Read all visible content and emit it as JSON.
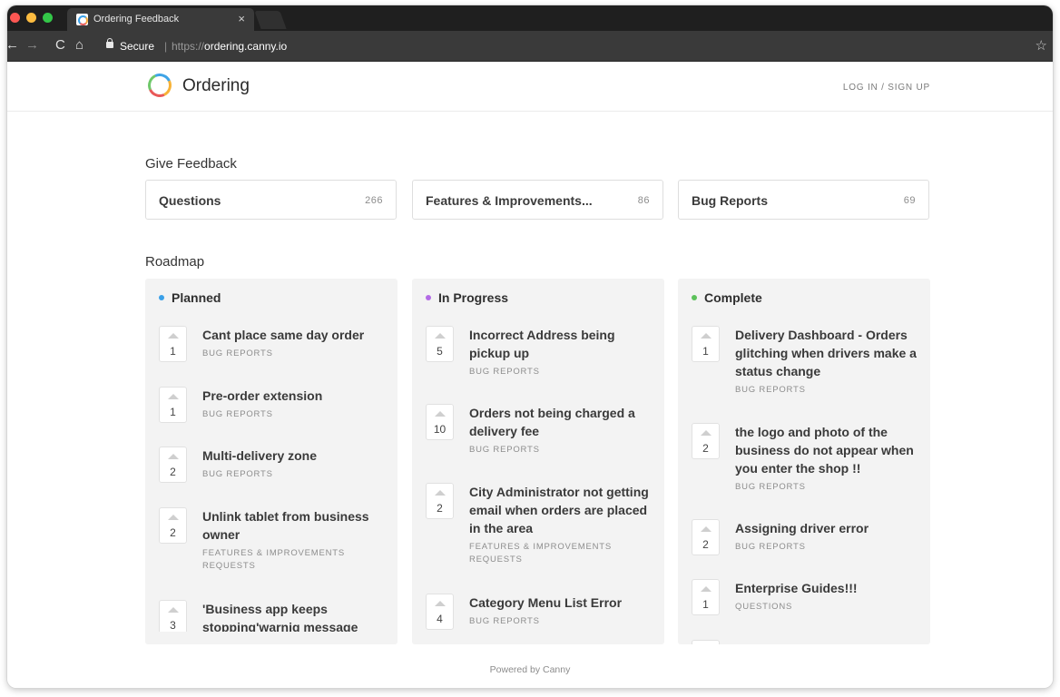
{
  "browser": {
    "tab_title": "Ordering Feedback",
    "tab_close": "×",
    "secure_label": "Secure",
    "url_separator": "|",
    "url_protocol": "https://",
    "url_host": "ordering.canny.io",
    "back_icon": "←",
    "forward_icon": "→",
    "reload_icon": "C",
    "home_icon": "⌂",
    "star_icon": "☆"
  },
  "header": {
    "brand": "Ordering",
    "login": "LOG IN / SIGN UP"
  },
  "give_feedback": {
    "title": "Give Feedback",
    "boards": [
      {
        "name": "Questions",
        "count": "266"
      },
      {
        "name": "Features & Improvements...",
        "count": "86"
      },
      {
        "name": "Bug Reports",
        "count": "69"
      }
    ]
  },
  "roadmap": {
    "title": "Roadmap",
    "columns": [
      {
        "name": "Planned",
        "color": "#3aa0e8",
        "posts": [
          {
            "votes": "1",
            "title": "Cant place same day order",
            "category": "BUG REPORTS"
          },
          {
            "votes": "1",
            "title": "Pre-order extension",
            "category": "BUG REPORTS"
          },
          {
            "votes": "2",
            "title": "Multi-delivery zone",
            "category": "BUG REPORTS"
          },
          {
            "votes": "2",
            "title": "Unlink tablet from business owner",
            "category": "FEATURES & IMPROVEMENTS REQUESTS"
          },
          {
            "votes": "3",
            "title": "'Business app keeps stopping'warnig message everytime our customers",
            "category": ""
          }
        ]
      },
      {
        "name": "In Progress",
        "color": "#b36be6",
        "posts": [
          {
            "votes": "5",
            "title": "Incorrect Address being pickup up",
            "category": "BUG REPORTS"
          },
          {
            "votes": "10",
            "title": "Orders not being charged a delivery fee",
            "category": "BUG REPORTS"
          },
          {
            "votes": "2",
            "title": "City Administrator not getting email when orders are placed in the area",
            "category": "FEATURES & IMPROVEMENTS REQUESTS"
          },
          {
            "votes": "4",
            "title": "Category Menu List Error",
            "category": "BUG REPORTS"
          }
        ]
      },
      {
        "name": "Complete",
        "color": "#5cc15a",
        "posts": [
          {
            "votes": "1",
            "title": "Delivery Dashboard - Orders glitching when drivers make a status change",
            "category": "BUG REPORTS"
          },
          {
            "votes": "2",
            "title": "the logo and photo of the business do not appear when you enter the shop !!",
            "category": "BUG REPORTS"
          },
          {
            "votes": "2",
            "title": "Assigning driver error",
            "category": "BUG REPORTS"
          },
          {
            "votes": "1",
            "title": "Enterprise Guides!!!",
            "category": "QUESTIONS"
          }
        ]
      }
    ]
  },
  "footer": {
    "powered": "Powered by Canny"
  }
}
